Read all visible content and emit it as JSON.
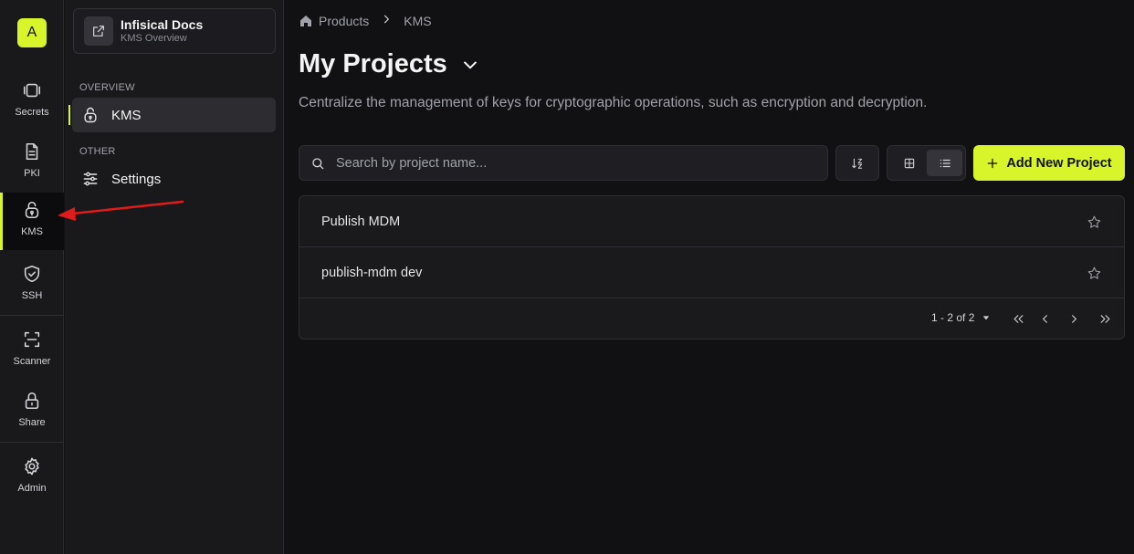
{
  "rail": {
    "avatar": "A",
    "items": [
      {
        "label": "Secrets",
        "icon": "secrets-icon"
      },
      {
        "label": "PKI",
        "icon": "document-icon"
      },
      {
        "label": "KMS",
        "icon": "lock-open-icon"
      },
      {
        "label": "SSH",
        "icon": "shield-check-icon"
      },
      {
        "label": "Scanner",
        "icon": "scan-icon"
      },
      {
        "label": "Share",
        "icon": "lock-icon"
      },
      {
        "label": "Admin",
        "icon": "gear-icon"
      }
    ],
    "active": "KMS"
  },
  "panel": {
    "docs_title": "Infisical Docs",
    "docs_subtitle": "KMS Overview",
    "overview_label": "OVERVIEW",
    "kms_label": "KMS",
    "other_label": "OTHER",
    "settings_label": "Settings"
  },
  "main": {
    "breadcrumb": {
      "products": "Products",
      "current": "KMS"
    },
    "title": "My Projects",
    "subtitle": "Centralize the management of keys for cryptographic operations, such as encryption and decryption.",
    "search_placeholder": "Search by project name...",
    "add_button": "Add New Project",
    "projects": [
      {
        "name": "Publish MDM"
      },
      {
        "name": "publish-mdm dev"
      }
    ],
    "pagination": {
      "range": "1 - 2 of 2"
    }
  },
  "colors": {
    "accent": "#d7f52a",
    "background": "#111113",
    "panel": "#19191c",
    "annotation_arrow": "#e01b1b"
  }
}
